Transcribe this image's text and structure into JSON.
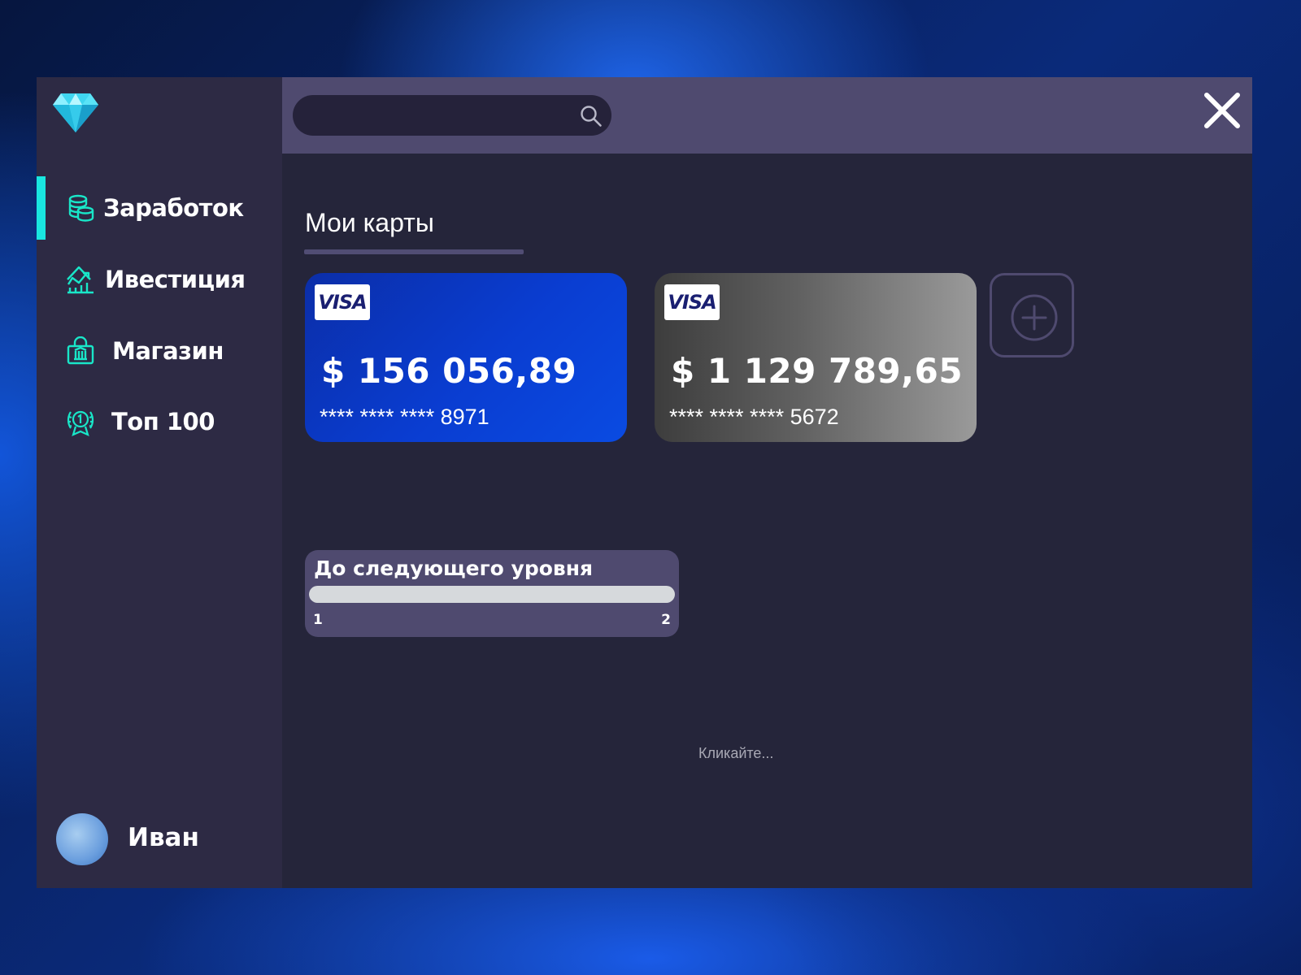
{
  "sidebar": {
    "items": [
      {
        "label": "Заработок",
        "icon": "coins-icon",
        "active": true
      },
      {
        "label": "Ивестиция",
        "icon": "growth-chart-icon",
        "active": false
      },
      {
        "label": "Магазин",
        "icon": "shopping-bag-icon",
        "active": false
      },
      {
        "label": "Топ 100",
        "icon": "laurel-medal-icon",
        "active": false
      }
    ],
    "user": {
      "name": "Иван"
    }
  },
  "topbar": {
    "search": {
      "value": "",
      "placeholder": ""
    },
    "close_icon": "close-icon"
  },
  "main": {
    "section_title": "Мои карты",
    "cards": [
      {
        "brand": "VISA",
        "balance": "$ 156 056,89",
        "number": "**** **** **** 8971",
        "color": "#0a3dd1"
      },
      {
        "brand": "VISA",
        "balance": "$ 1 129 789,65",
        "number": "**** **** **** 5672",
        "color": "#6a6a6a"
      }
    ],
    "add_card_icon": "plus-circle-icon",
    "level": {
      "label": "До следующего уровня",
      "from": "1",
      "to": "2",
      "progress": 0
    },
    "hint": "Кликайте..."
  },
  "colors": {
    "accent": "#19e6e0",
    "sidebar_bg": "#2d2a44",
    "main_bg": "#25253a",
    "topbar_bg": "#4f4a6f"
  }
}
